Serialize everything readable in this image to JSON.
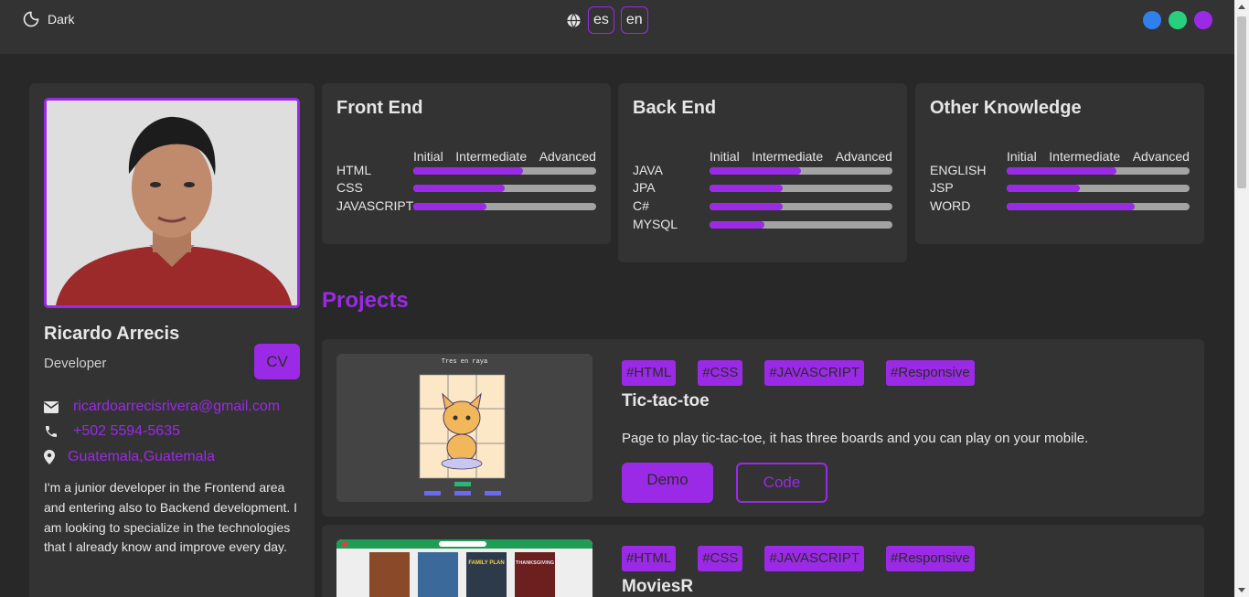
{
  "header": {
    "theme_label": "Dark",
    "languages": [
      "es",
      "en"
    ],
    "theme_colors": [
      "#2f80ed",
      "#27d07c",
      "#9b2ae6"
    ]
  },
  "profile": {
    "name": "Ricardo Arrecis",
    "role": "Developer",
    "cv_label": "CV",
    "email": "ricardoarrecisrivera@gmail.com",
    "phone": "+502 5594-5635",
    "location": "Guatemala,Guatemala",
    "bio": "I'm a junior developer in the Frontend area and entering also to Backend development. I am looking to specialize in the technologies that I already know and improve every day."
  },
  "skills": {
    "levels": [
      "Initial",
      "Intermediate",
      "Advanced"
    ],
    "frontend": {
      "title": "Front End",
      "items": [
        {
          "name": "HTML",
          "level": 0.6
        },
        {
          "name": "CSS",
          "level": 0.5
        },
        {
          "name": "JAVASCRIPT",
          "level": 0.4
        }
      ]
    },
    "backend": {
      "title": "Back End",
      "items": [
        {
          "name": "JAVA",
          "level": 0.5
        },
        {
          "name": "JPA",
          "level": 0.4
        },
        {
          "name": "C#",
          "level": 0.4
        },
        {
          "name": "MYSQL",
          "level": 0.3
        }
      ]
    },
    "other": {
      "title": "Other Knowledge",
      "items": [
        {
          "name": "ENGLISH",
          "level": 0.6
        },
        {
          "name": "JSP",
          "level": 0.4
        },
        {
          "name": "WORD",
          "level": 0.7
        }
      ]
    }
  },
  "projects": {
    "title": "Projects",
    "items": [
      {
        "tags": [
          "#HTML",
          "#CSS",
          "#JAVASCRIPT",
          "#Responsive"
        ],
        "title": "Tic-tac-toe",
        "description": "Page to play tic-tac-toe, it has three boards and you can play on your mobile.",
        "demo_label": "Demo",
        "code_label": "Code",
        "preview_caption": "Tres en raya"
      },
      {
        "tags": [
          "#HTML",
          "#CSS",
          "#JAVASCRIPT",
          "#Responsive"
        ],
        "title": "MoviesR",
        "poster_titles": [
          "FAMILY PLAN",
          "THANKSGIVING"
        ]
      }
    ]
  }
}
